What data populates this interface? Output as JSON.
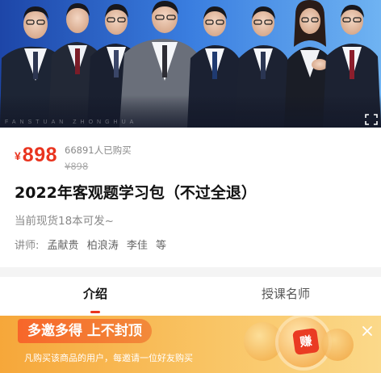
{
  "hero": {
    "watermark": "FANSTUAN ZHONGHUA",
    "colors": {
      "bg_left": "#1f4fb8",
      "bg_right": "#5aa6f0"
    }
  },
  "product": {
    "currency_symbol": "¥",
    "price": "898",
    "sold_count": "66891人已购买",
    "original_price": "¥898",
    "title": "2022年客观题学习包（不过全退）",
    "stock_note": "当前现货18本可发~",
    "teachers_label": "讲师:",
    "teachers": [
      "孟献贵",
      "柏浪涛",
      "李佳",
      "等"
    ]
  },
  "tabs": [
    {
      "label": "介绍",
      "active": true
    },
    {
      "label": "授课名师",
      "active": false
    }
  ],
  "promo": {
    "headline": "多邀多得 上不封顶",
    "description": "凡购买该商品的用户，每邀请一位好友购买",
    "badge": "赚",
    "icons": {
      "close": "close-icon",
      "fullscreen": "fullscreen-icon"
    }
  },
  "colors": {
    "accent": "#e9341f",
    "muted": "#888888"
  }
}
